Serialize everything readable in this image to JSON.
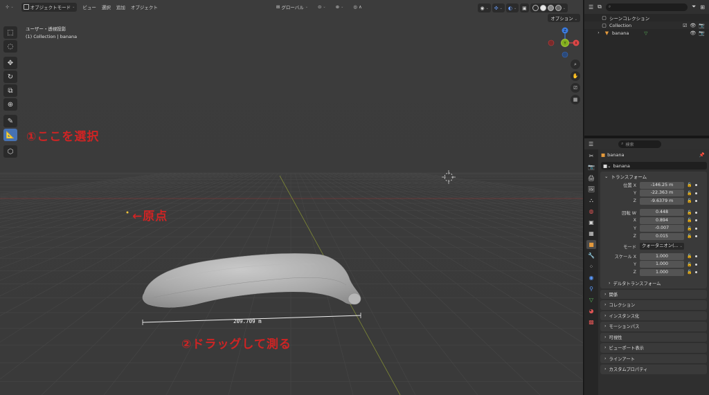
{
  "viewport": {
    "mode_label": "オブジェクトモード",
    "menus": [
      "ビュー",
      "選択",
      "追加",
      "オブジェクト"
    ],
    "transform_orientation": "グローバル",
    "options_label": "オプション",
    "view_name": "ユーザー・透視投影",
    "collection_info": "(1) Collection | banana",
    "gizmo_axes": {
      "x": "X",
      "y": "Y",
      "z": "Z"
    },
    "measure_value": "209.709 m"
  },
  "annotations": {
    "step1": "①ここを選択",
    "origin": "←原点",
    "step2": "②ドラッグして測る"
  },
  "outliner": {
    "search_placeholder": "",
    "scene_collection": "シーンコレクション",
    "collection": "Collection",
    "object": "banana"
  },
  "properties": {
    "search_placeholder": "検索",
    "object_name": "banana",
    "datablock_name": "banana",
    "transform_panel": "トランスフォーム",
    "location_label": "位置 X",
    "location": {
      "x": "-146.25 m",
      "y": "-22.363 m",
      "z": "-9.6379 m"
    },
    "rotation_label": "回転 W",
    "rotation": {
      "w": "0.448",
      "x": "0.894",
      "y": "-0.007",
      "z": "0.015"
    },
    "axis_labels": {
      "x": "X",
      "y": "Y",
      "z": "Z"
    },
    "mode_label": "モード",
    "mode_value": "クォータニオン(...",
    "scale_label": "スケール X",
    "scale": {
      "x": "1.000",
      "y": "1.000",
      "z": "1.000"
    },
    "delta_transform": "デルタトランスフォーム",
    "collapsed_panels": [
      "関係",
      "コレクション",
      "インスタンス化",
      "モーションパス",
      "可視性",
      "ビューポート表示",
      "ラインアート",
      "カスタムプロパティ"
    ]
  },
  "colors": {
    "accent": "#4772b3",
    "annotation": "#cf2424",
    "axis_x": "#e04848",
    "axis_y": "#83b01e",
    "axis_z": "#3a7be0"
  }
}
